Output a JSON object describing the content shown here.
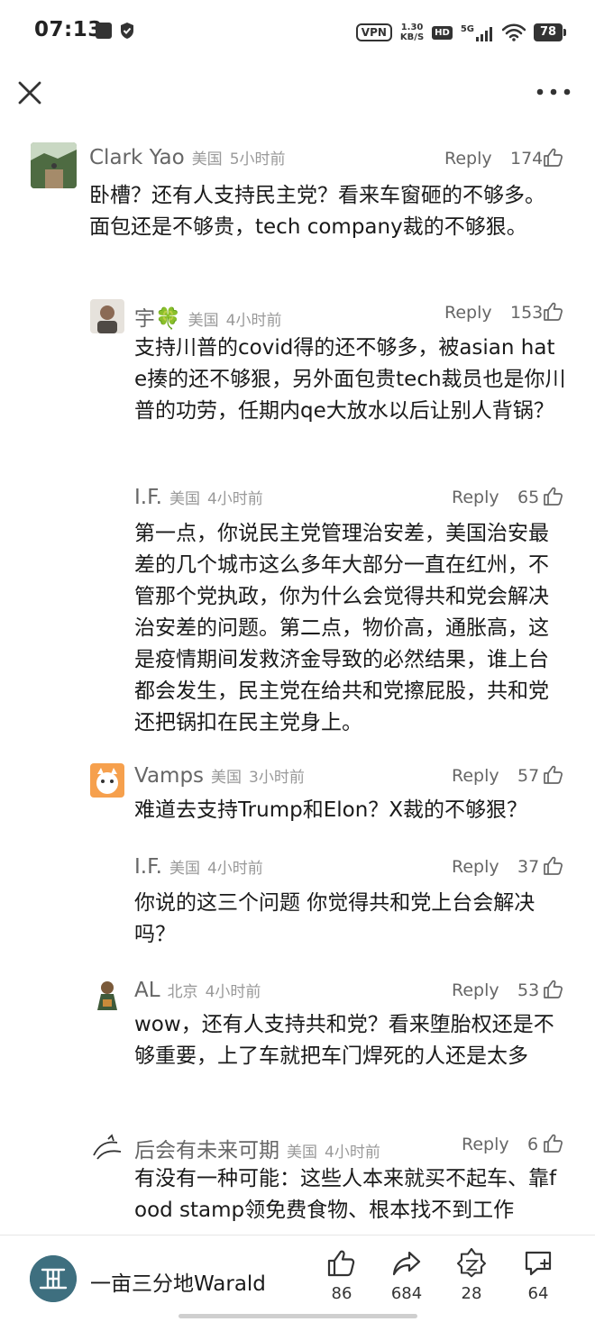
{
  "status_bar": {
    "time": "07:13",
    "vpn": "VPN",
    "speed_value": "1.30",
    "speed_unit": "KB/S",
    "hd": "HD",
    "network": "5G",
    "battery": "78"
  },
  "comments": [
    {
      "author": "Clark Yao",
      "location": "美国",
      "time": "5小时前",
      "reply_label": "Reply",
      "likes": "174",
      "text": "卧槽？还有人支持民主党？看来车窗砸的不够多。面包还是不够贵，tech company裁的不够狠。"
    },
    {
      "author": "宇🍀",
      "location": "美国",
      "time": "4小时前",
      "reply_label": "Reply",
      "likes": "153",
      "text": "支持川普的covid得的还不够多，被asian hate揍的还不够狠，另外面包贵tech裁员也是你川普的功劳，任期内qe大放水以后让别人背锅？"
    },
    {
      "author": "I.F.",
      "location": "美国",
      "time": "4小时前",
      "reply_label": "Reply",
      "likes": "65",
      "text": "第一点，你说民主党管理治安差，美国治安最差的几个城市这么多年大部分一直在红州，不管那个党执政，你为什么会觉得共和党会解决治安差的问题。第二点，物价高，通胀高，这是疫情期间发救济金导致的必然结果，谁上台都会发生，民主党在给共和党擦屁股，共和党还把锅扣在民主党身上。"
    },
    {
      "author": "Vamps",
      "location": "美国",
      "time": "3小时前",
      "reply_label": "Reply",
      "likes": "57",
      "text": "难道去支持Trump和Elon？X裁的不够狠？"
    },
    {
      "author": "I.F.",
      "location": "美国",
      "time": "4小时前",
      "reply_label": "Reply",
      "likes": "37",
      "text": "你说的这三个问题 你觉得共和党上台会解决吗？"
    },
    {
      "author": "AL",
      "location": "北京",
      "time": "4小时前",
      "reply_label": "Reply",
      "likes": "53",
      "text": "wow，还有人支持共和党？看来堕胎权还是不够重要，上了车就把车门焊死的人还是太多"
    },
    {
      "author": "后会有未来可期",
      "location": "美国",
      "time": "4小时前",
      "reply_label": "Reply",
      "likes": "6",
      "text": "有没有一种可能：这些人本来就买不起车、靠food stamp领免费食物、根本找不到工作"
    }
  ],
  "bottom_bar": {
    "brand_name": "一亩三分地Warald",
    "actions": [
      {
        "name": "like",
        "count": "86"
      },
      {
        "name": "share",
        "count": "684"
      },
      {
        "name": "collect",
        "count": "28"
      },
      {
        "name": "comment",
        "count": "64"
      }
    ]
  },
  "colors": {
    "text_primary": "#1a1a1a",
    "text_secondary": "#666666",
    "text_meta": "#999999",
    "brand_avatar": "#3e6f7f"
  }
}
